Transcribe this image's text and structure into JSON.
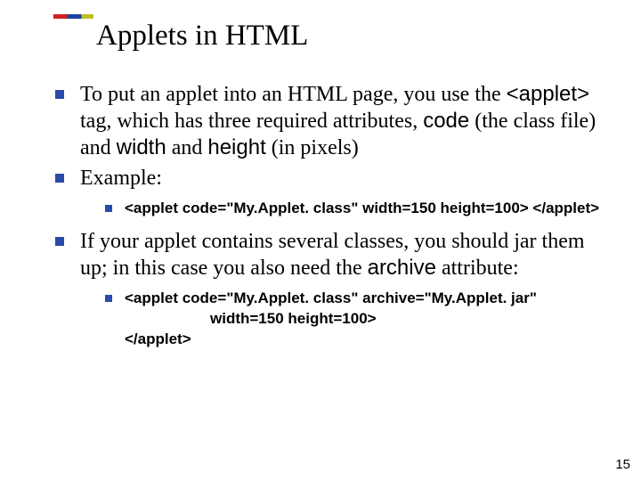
{
  "title": "Applets in HTML",
  "bullets": {
    "b1": {
      "prefix": "To put an applet into an HTML page, you use the ",
      "code1": "<applet>",
      "mid1": " tag, which has three required attributes, ",
      "code2": "code",
      "mid2": " (the class file) and ",
      "code3": "width",
      "mid3": " and ",
      "code4": "height",
      "suffix": " (in pixels)"
    },
    "b2": "Example:",
    "b2sub": "<applet code=\"My.Applet. class\"  width=150  height=100> </applet>",
    "b3": {
      "prefix": "If your applet contains several classes, you should jar them up; in this case you also need the ",
      "code1": "archive",
      "suffix": " attribute:"
    },
    "b3sub": {
      "l1": "<applet  code=\"My.Applet. class\"   archive=\"My.Applet. jar\"",
      "l2": "width=150   height=100>",
      "l3": "</applet>"
    }
  },
  "pageNumber": "15"
}
